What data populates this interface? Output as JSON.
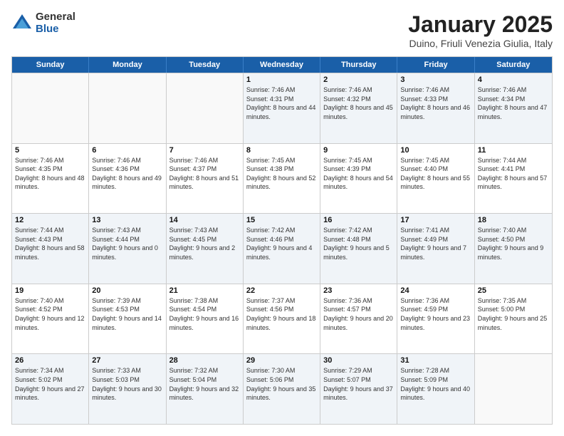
{
  "logo": {
    "general": "General",
    "blue": "Blue"
  },
  "header": {
    "title": "January 2025",
    "subtitle": "Duino, Friuli Venezia Giulia, Italy"
  },
  "days": [
    "Sunday",
    "Monday",
    "Tuesday",
    "Wednesday",
    "Thursday",
    "Friday",
    "Saturday"
  ],
  "weeks": [
    [
      {
        "day": "",
        "empty": true
      },
      {
        "day": "",
        "empty": true
      },
      {
        "day": "",
        "empty": true
      },
      {
        "day": "1",
        "sunrise": "7:46 AM",
        "sunset": "4:31 PM",
        "daylight": "8 hours and 44 minutes."
      },
      {
        "day": "2",
        "sunrise": "7:46 AM",
        "sunset": "4:32 PM",
        "daylight": "8 hours and 45 minutes."
      },
      {
        "day": "3",
        "sunrise": "7:46 AM",
        "sunset": "4:33 PM",
        "daylight": "8 hours and 46 minutes."
      },
      {
        "day": "4",
        "sunrise": "7:46 AM",
        "sunset": "4:34 PM",
        "daylight": "8 hours and 47 minutes."
      }
    ],
    [
      {
        "day": "5",
        "sunrise": "7:46 AM",
        "sunset": "4:35 PM",
        "daylight": "8 hours and 48 minutes."
      },
      {
        "day": "6",
        "sunrise": "7:46 AM",
        "sunset": "4:36 PM",
        "daylight": "8 hours and 49 minutes."
      },
      {
        "day": "7",
        "sunrise": "7:46 AM",
        "sunset": "4:37 PM",
        "daylight": "8 hours and 51 minutes."
      },
      {
        "day": "8",
        "sunrise": "7:45 AM",
        "sunset": "4:38 PM",
        "daylight": "8 hours and 52 minutes."
      },
      {
        "day": "9",
        "sunrise": "7:45 AM",
        "sunset": "4:39 PM",
        "daylight": "8 hours and 54 minutes."
      },
      {
        "day": "10",
        "sunrise": "7:45 AM",
        "sunset": "4:40 PM",
        "daylight": "8 hours and 55 minutes."
      },
      {
        "day": "11",
        "sunrise": "7:44 AM",
        "sunset": "4:41 PM",
        "daylight": "8 hours and 57 minutes."
      }
    ],
    [
      {
        "day": "12",
        "sunrise": "7:44 AM",
        "sunset": "4:43 PM",
        "daylight": "8 hours and 58 minutes."
      },
      {
        "day": "13",
        "sunrise": "7:43 AM",
        "sunset": "4:44 PM",
        "daylight": "9 hours and 0 minutes."
      },
      {
        "day": "14",
        "sunrise": "7:43 AM",
        "sunset": "4:45 PM",
        "daylight": "9 hours and 2 minutes."
      },
      {
        "day": "15",
        "sunrise": "7:42 AM",
        "sunset": "4:46 PM",
        "daylight": "9 hours and 4 minutes."
      },
      {
        "day": "16",
        "sunrise": "7:42 AM",
        "sunset": "4:48 PM",
        "daylight": "9 hours and 5 minutes."
      },
      {
        "day": "17",
        "sunrise": "7:41 AM",
        "sunset": "4:49 PM",
        "daylight": "9 hours and 7 minutes."
      },
      {
        "day": "18",
        "sunrise": "7:40 AM",
        "sunset": "4:50 PM",
        "daylight": "9 hours and 9 minutes."
      }
    ],
    [
      {
        "day": "19",
        "sunrise": "7:40 AM",
        "sunset": "4:52 PM",
        "daylight": "9 hours and 12 minutes."
      },
      {
        "day": "20",
        "sunrise": "7:39 AM",
        "sunset": "4:53 PM",
        "daylight": "9 hours and 14 minutes."
      },
      {
        "day": "21",
        "sunrise": "7:38 AM",
        "sunset": "4:54 PM",
        "daylight": "9 hours and 16 minutes."
      },
      {
        "day": "22",
        "sunrise": "7:37 AM",
        "sunset": "4:56 PM",
        "daylight": "9 hours and 18 minutes."
      },
      {
        "day": "23",
        "sunrise": "7:36 AM",
        "sunset": "4:57 PM",
        "daylight": "9 hours and 20 minutes."
      },
      {
        "day": "24",
        "sunrise": "7:36 AM",
        "sunset": "4:59 PM",
        "daylight": "9 hours and 23 minutes."
      },
      {
        "day": "25",
        "sunrise": "7:35 AM",
        "sunset": "5:00 PM",
        "daylight": "9 hours and 25 minutes."
      }
    ],
    [
      {
        "day": "26",
        "sunrise": "7:34 AM",
        "sunset": "5:02 PM",
        "daylight": "9 hours and 27 minutes."
      },
      {
        "day": "27",
        "sunrise": "7:33 AM",
        "sunset": "5:03 PM",
        "daylight": "9 hours and 30 minutes."
      },
      {
        "day": "28",
        "sunrise": "7:32 AM",
        "sunset": "5:04 PM",
        "daylight": "9 hours and 32 minutes."
      },
      {
        "day": "29",
        "sunrise": "7:30 AM",
        "sunset": "5:06 PM",
        "daylight": "9 hours and 35 minutes."
      },
      {
        "day": "30",
        "sunrise": "7:29 AM",
        "sunset": "5:07 PM",
        "daylight": "9 hours and 37 minutes."
      },
      {
        "day": "31",
        "sunrise": "7:28 AM",
        "sunset": "5:09 PM",
        "daylight": "9 hours and 40 minutes."
      },
      {
        "day": "",
        "empty": true
      }
    ]
  ]
}
